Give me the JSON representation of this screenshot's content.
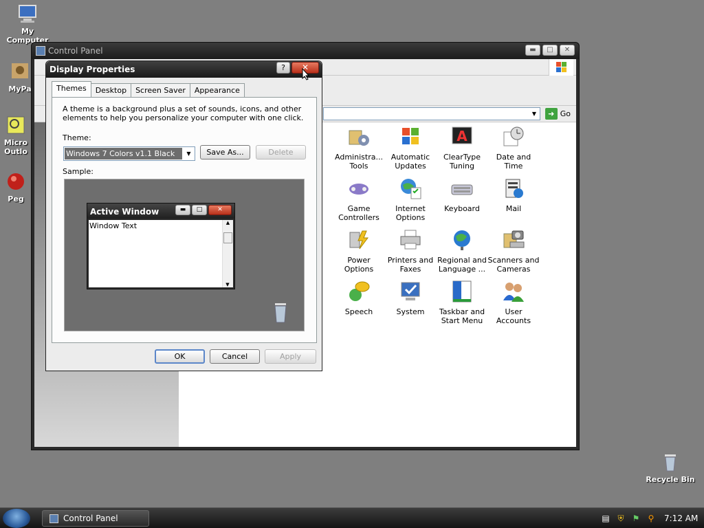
{
  "desktop": {
    "icons": [
      {
        "label": "My Computer",
        "icon": "my-computer-icon"
      },
      {
        "label": "MyPa",
        "icon": "my-pictures-icon"
      },
      {
        "label": "Micro Outlo",
        "icon": "outlook-icon"
      },
      {
        "label": "Peg",
        "icon": "pegasus-icon"
      },
      {
        "label": "Recycle Bin",
        "icon": "recycle-bin-icon"
      }
    ]
  },
  "control_panel": {
    "title": "Control Panel",
    "go_label": "Go",
    "items": [
      {
        "label": "Administra... Tools",
        "icon": "administrative-tools-icon"
      },
      {
        "label": "Automatic Updates",
        "icon": "automatic-updates-icon"
      },
      {
        "label": "ClearType Tuning",
        "icon": "cleartype-icon"
      },
      {
        "label": "Date and Time",
        "icon": "date-time-icon"
      },
      {
        "label": "Game Controllers",
        "icon": "game-controller-icon"
      },
      {
        "label": "Internet Options",
        "icon": "internet-options-icon"
      },
      {
        "label": "Keyboard",
        "icon": "keyboard-icon"
      },
      {
        "label": "Mail",
        "icon": "mail-icon"
      },
      {
        "label": "Power Options",
        "icon": "power-options-icon"
      },
      {
        "label": "Printers and Faxes",
        "icon": "printer-icon"
      },
      {
        "label": "Regional and Language ...",
        "icon": "globe-icon"
      },
      {
        "label": "Scanners and Cameras",
        "icon": "scanner-icon"
      },
      {
        "label": "Speech",
        "icon": "speech-icon"
      },
      {
        "label": "System",
        "icon": "system-icon"
      },
      {
        "label": "Taskbar and Start Menu",
        "icon": "taskbar-icon"
      },
      {
        "label": "User Accounts",
        "icon": "user-accounts-icon"
      }
    ]
  },
  "dialog": {
    "title": "Display Properties",
    "help": "?",
    "close": "✕",
    "tabs": [
      "Themes",
      "Desktop",
      "Screen Saver",
      "Appearance"
    ],
    "description": "A theme is a background plus a set of sounds, icons, and other elements to help you personalize your computer with one click.",
    "theme_label": "Theme:",
    "theme_value": "Windows 7 Colors v1.1 Black",
    "save_as": "Save As...",
    "delete": "Delete",
    "sample_label": "Sample:",
    "sample_window_title": "Active Window",
    "sample_window_text": "Window Text",
    "ok": "OK",
    "cancel": "Cancel",
    "apply": "Apply"
  },
  "taskbar": {
    "task": "Control Panel",
    "time": "7:12 AM"
  }
}
